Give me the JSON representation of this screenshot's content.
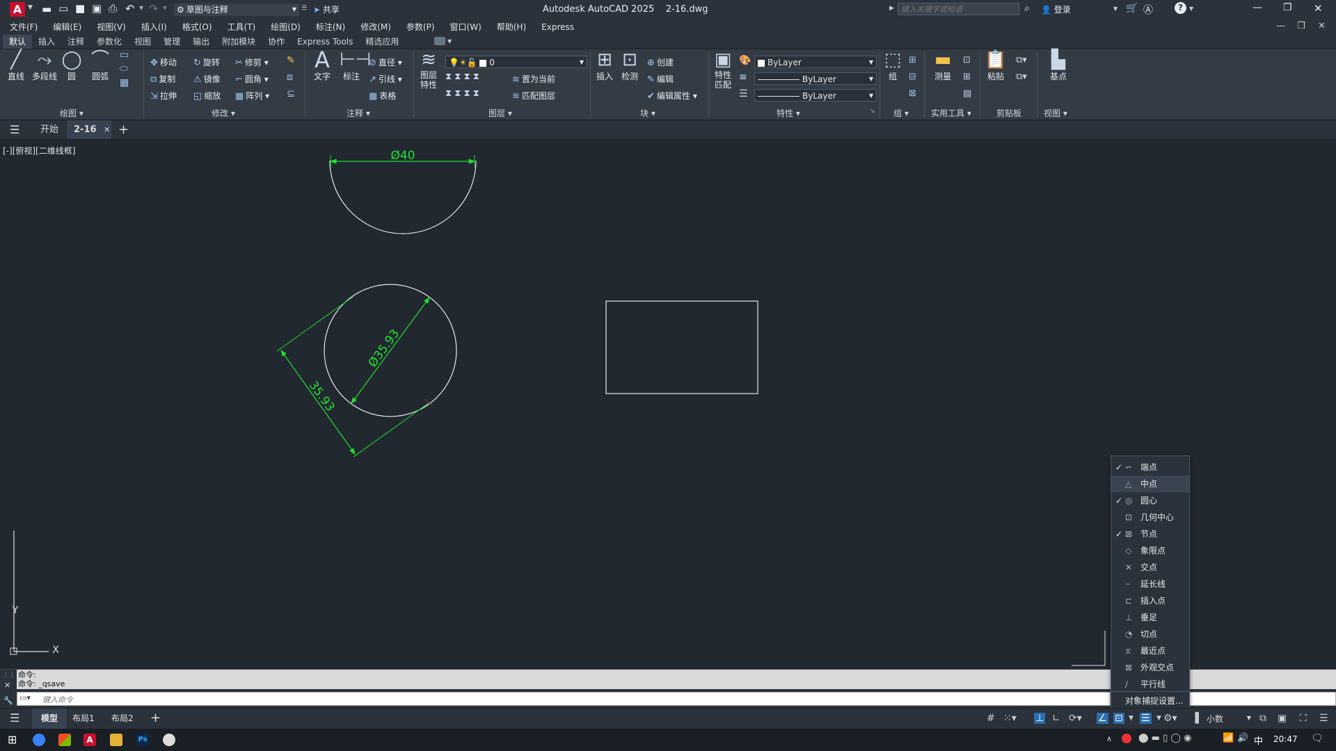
{
  "app": {
    "logo": "A",
    "title": "Autodesk AutoCAD 2025",
    "file": "2-16.dwg",
    "workspace": "草图与注释",
    "share": "共享",
    "search_placeholder": "键入关键字或短语",
    "login": "登录"
  },
  "menubar": [
    "文件(F)",
    "编辑(E)",
    "视图(V)",
    "插入(I)",
    "格式(O)",
    "工具(T)",
    "绘图(D)",
    "标注(N)",
    "修改(M)",
    "参数(P)",
    "窗口(W)",
    "帮助(H)",
    "Express"
  ],
  "ribbon_tabs": [
    "默认",
    "插入",
    "注释",
    "参数化",
    "视图",
    "管理",
    "输出",
    "附加模块",
    "协作",
    "Express Tools",
    "精选应用"
  ],
  "ribbon": {
    "draw": {
      "title": "绘图",
      "tools": [
        "直线",
        "多段线",
        "圆",
        "圆弧"
      ]
    },
    "modify": {
      "title": "修改",
      "tools": [
        "移动",
        "旋转",
        "修剪",
        "复制",
        "镜像",
        "圆角",
        "拉伸",
        "缩放",
        "阵列"
      ]
    },
    "annotation": {
      "title": "注释",
      "tools": [
        "文字",
        "标注",
        "直径",
        "引线",
        "表格"
      ]
    },
    "layers": {
      "title": "图层",
      "layer_props": "图层特性",
      "current_layer": "0",
      "tools": [
        "置为当前",
        "匹配图层"
      ]
    },
    "block": {
      "title": "块",
      "insert": "插入",
      "check": "检测",
      "tools": [
        "创建",
        "编辑",
        "编辑属性"
      ]
    },
    "properties": {
      "title": "特性",
      "match": "特性匹配",
      "color": "ByLayer",
      "linetype": "ByLayer",
      "lineweight": "ByLayer"
    },
    "groups": {
      "title": "组",
      "tools": [
        "组"
      ]
    },
    "utilities": {
      "title": "实用工具",
      "tools": [
        "测量"
      ]
    },
    "clipboard": {
      "title": "剪贴板",
      "tools": [
        "粘贴"
      ]
    },
    "view": {
      "title": "视图",
      "tools": [
        "基点"
      ]
    }
  },
  "doc_tabs": [
    "开始",
    "2-16"
  ],
  "viewport_label": "[-][俯视][二维线框]",
  "drawing": {
    "dim_top": "Ø40",
    "dim_diameter": "Ø35.93",
    "dim_aligned": "35.93",
    "ucs_x": "X",
    "ucs_y": "Y"
  },
  "command": {
    "history": [
      "命令:",
      "命令:  _qsave"
    ],
    "placeholder": "键入命令"
  },
  "snap_menu": {
    "items": [
      {
        "label": "端点",
        "checked": true,
        "icon": "endpoint-icon"
      },
      {
        "label": "中点",
        "checked": false,
        "icon": "midpoint-icon"
      },
      {
        "label": "圆心",
        "checked": true,
        "icon": "center-icon"
      },
      {
        "label": "几何中心",
        "checked": false,
        "icon": "geometric-center-icon"
      },
      {
        "label": "节点",
        "checked": true,
        "icon": "node-icon"
      },
      {
        "label": "象限点",
        "checked": false,
        "icon": "quadrant-icon"
      },
      {
        "label": "交点",
        "checked": false,
        "icon": "intersection-icon"
      },
      {
        "label": "延长线",
        "checked": false,
        "icon": "extension-icon"
      },
      {
        "label": "插入点",
        "checked": false,
        "icon": "insertion-icon"
      },
      {
        "label": "垂足",
        "checked": false,
        "icon": "perpendicular-icon"
      },
      {
        "label": "切点",
        "checked": false,
        "icon": "tangent-icon"
      },
      {
        "label": "最近点",
        "checked": false,
        "icon": "nearest-icon"
      },
      {
        "label": "外观交点",
        "checked": false,
        "icon": "apparent-intersection-icon"
      },
      {
        "label": "平行线",
        "checked": false,
        "icon": "parallel-icon"
      }
    ],
    "settings": "对象捕捉设置..."
  },
  "layout_tabs": [
    "模型",
    "布局1",
    "布局2"
  ],
  "status": {
    "units": "小数"
  },
  "taskbar": {
    "ime": "中",
    "time": "20:47"
  },
  "colors": {
    "dim": "#22e02e",
    "geometry": "#e8e8e8",
    "canvas": "#212830"
  }
}
